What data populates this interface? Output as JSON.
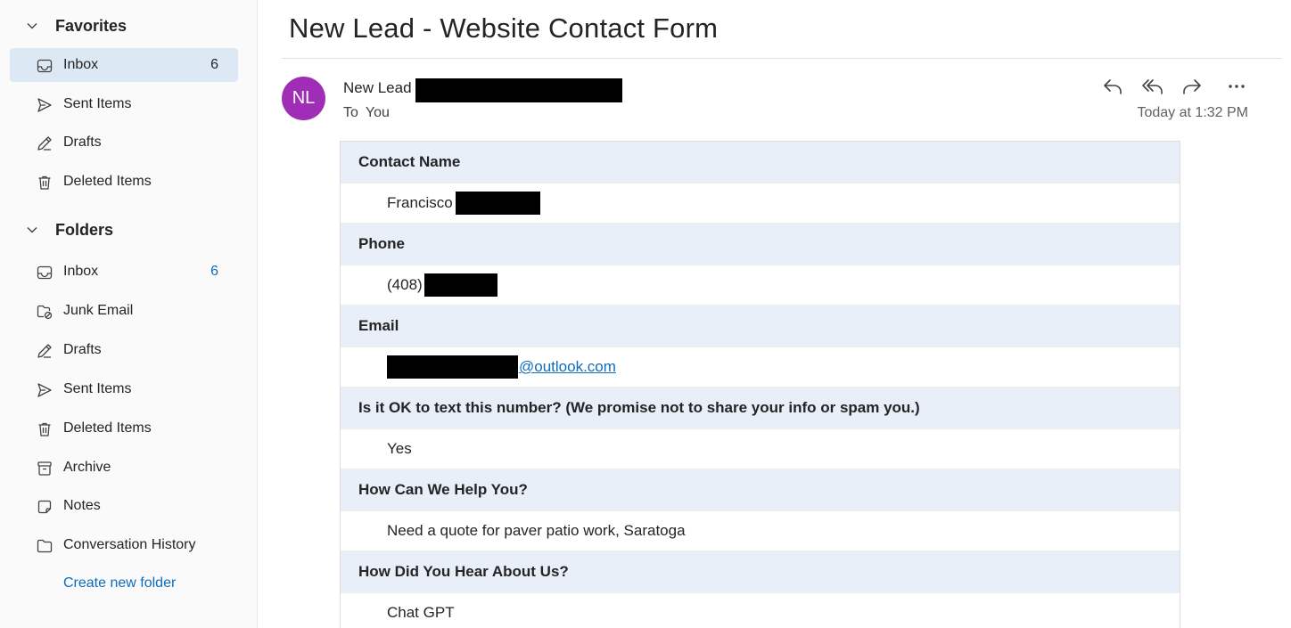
{
  "sidebar": {
    "favorites": {
      "title": "Favorites",
      "items": [
        {
          "label": "Inbox",
          "count": "6",
          "icon": "inbox-icon"
        },
        {
          "label": "Sent Items",
          "icon": "send-icon"
        },
        {
          "label": "Drafts",
          "icon": "pencil-icon"
        },
        {
          "label": "Deleted Items",
          "icon": "trash-icon"
        }
      ]
    },
    "folders": {
      "title": "Folders",
      "items": [
        {
          "label": "Inbox",
          "count": "6",
          "icon": "inbox-icon"
        },
        {
          "label": "Junk Email",
          "icon": "junk-icon"
        },
        {
          "label": "Drafts",
          "icon": "pencil-icon"
        },
        {
          "label": "Sent Items",
          "icon": "send-icon"
        },
        {
          "label": "Deleted Items",
          "icon": "trash-icon"
        },
        {
          "label": "Archive",
          "icon": "archive-icon"
        },
        {
          "label": "Notes",
          "icon": "note-icon"
        },
        {
          "label": "Conversation History",
          "icon": "folder-icon"
        }
      ]
    },
    "create_folder": "Create new folder"
  },
  "message": {
    "subject": "New Lead - Website Contact Form",
    "avatar_initials": "NL",
    "sender_name": "New Lead",
    "to_label": "To",
    "to_value": "You",
    "timestamp": "Today at 1:32 PM",
    "actions": [
      "reply-icon",
      "reply-all-icon",
      "forward-icon",
      "more-icon"
    ]
  },
  "form": {
    "fields": [
      {
        "question": "Contact Name",
        "answer": "Francisco"
      },
      {
        "question": "Phone",
        "answer": "(408)"
      },
      {
        "question": "Email",
        "answer": "@outlook.com"
      },
      {
        "question": "Is it OK to text this number? (We promise not to share your info or spam you.)",
        "answer": "Yes"
      },
      {
        "question": "How Can We Help You?",
        "answer": "Need a quote for paver patio work, Saratoga"
      },
      {
        "question": "How Did You Hear About Us?",
        "answer": "Chat GPT"
      }
    ]
  },
  "colors": {
    "accent": "#0f6cbd",
    "selected_bg": "#dde8f5",
    "avatar": "#a02db5",
    "question_row_bg": "#e8eff9"
  }
}
